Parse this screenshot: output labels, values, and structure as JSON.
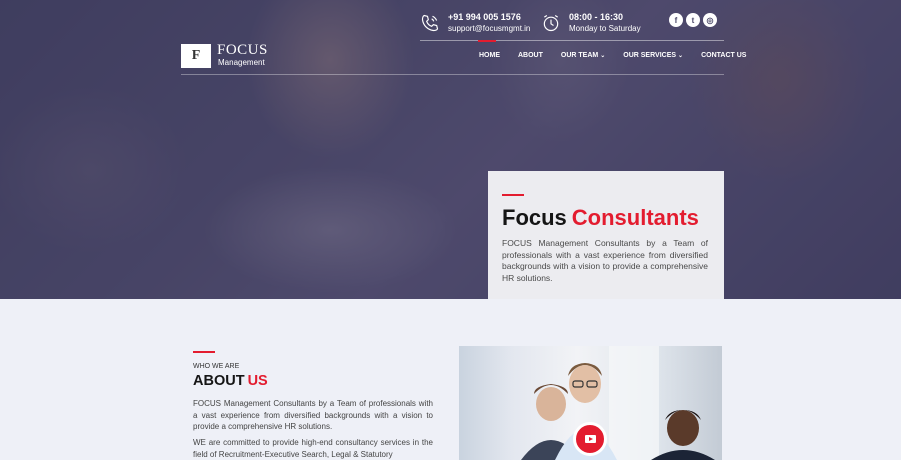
{
  "header": {
    "logo": {
      "letter": "F",
      "name": "FOCUS",
      "sub": "Management"
    },
    "phone": {
      "number": "+91 994 005 1576",
      "email": "support@focusmgmt.in",
      "icon": "phone-icon"
    },
    "hours": {
      "time": "08:00 - 16:30",
      "days": "Monday to Saturday",
      "icon": "clock-icon"
    },
    "social": [
      {
        "glyph": "f",
        "name": "facebook-icon"
      },
      {
        "glyph": "t",
        "name": "twitter-icon"
      },
      {
        "glyph": "◎",
        "name": "dribbble-icon"
      }
    ]
  },
  "nav": {
    "items": [
      {
        "label": "HOME",
        "active": true
      },
      {
        "label": "ABOUT"
      },
      {
        "label": "OUR TEAM",
        "dropdown": true
      },
      {
        "label": "OUR SERVICES",
        "dropdown": true
      },
      {
        "label": "CONTACT US"
      }
    ],
    "chevron": "⌄"
  },
  "hero": {
    "title_main": "Focus",
    "title_accent": "Consultants",
    "description": "FOCUS Management Consultants by a Team of professionals with a vast experience from diversified backgrounds with a vision to provide a comprehensive HR solutions."
  },
  "about": {
    "eyebrow": "WHO WE ARE",
    "title_main": "ABOUT",
    "title_accent": "US",
    "paragraph1": "FOCUS Management Consultants by a Team of professionals with a vast experience from diversified backgrounds with a vision to provide a comprehensive HR solutions.",
    "paragraph2": "WE are committed to provide high-end consultancy services in the field of Recruitment-Executive Search, Legal & Statutory"
  },
  "colors": {
    "accent": "#e31c2f",
    "overlay": "#37345a"
  }
}
